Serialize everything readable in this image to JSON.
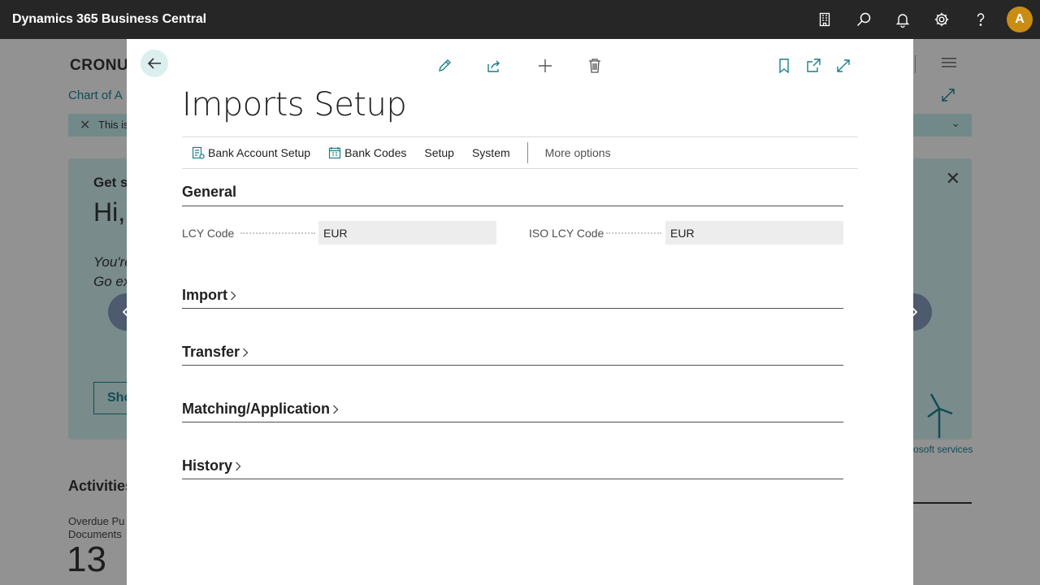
{
  "app": {
    "title": "Dynamics 365 Business Central",
    "avatar_initial": "A"
  },
  "topbar_icons": [
    "company-icon",
    "search-icon",
    "bell-icon",
    "settings-icon",
    "help-icon"
  ],
  "background": {
    "company_name": "CRONU",
    "chart_link": "Chart of A",
    "banner_text": "This is",
    "card_get": "Get s",
    "card_hi": "Hi,",
    "card_line1": "You're",
    "card_line2": "Go ex",
    "card_button": "Sho",
    "ms_services": "osoft services",
    "activities": "Activities",
    "overdue_line1": "Overdue Pu",
    "overdue_line2": "Documents",
    "overdue_count": "13"
  },
  "modal": {
    "title": "Imports Setup",
    "actions": [
      {
        "label": "Bank Account Setup",
        "icon": "bank-account-setup-icon"
      },
      {
        "label": "Bank Codes",
        "icon": "bank-codes-icon"
      },
      {
        "label": "Setup"
      },
      {
        "label": "System"
      }
    ],
    "more_options": "More options",
    "sections": {
      "general": "General",
      "import": "Import",
      "transfer": "Transfer",
      "matching": "Matching/Application",
      "history": "History"
    },
    "fields": {
      "lcy_code": {
        "label": "LCY Code",
        "value": "EUR"
      },
      "iso_lcy_code": {
        "label": "ISO LCY Code",
        "value": "EUR"
      }
    }
  },
  "colors": {
    "accent": "#1a7f8a",
    "topbar": "#262626",
    "avatar": "#c98d14",
    "nav_arrow": "#4e5a6e"
  }
}
